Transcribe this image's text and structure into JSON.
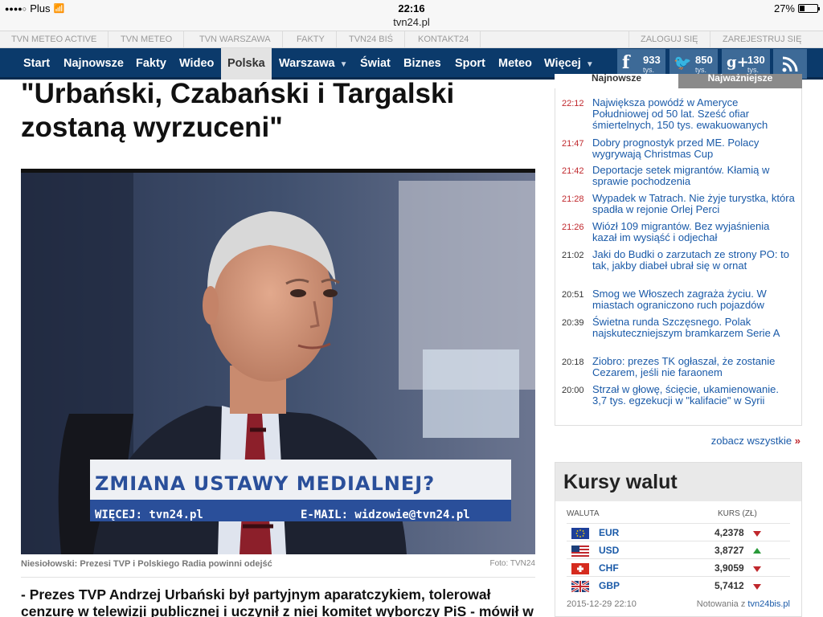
{
  "status_bar": {
    "carrier": "Plus",
    "time": "22:16",
    "battery": "27%",
    "battery_level": 0.27
  },
  "browser": {
    "url": "tvn24.pl"
  },
  "service_links": [
    "TVN METEO ACTIVE",
    "TVN METEO",
    "TVN WARSZAWA",
    "FAKTY",
    "TVN24 BiŚ",
    "KONTAKT24"
  ],
  "account_links": {
    "login": "ZALOGUJ SIĘ",
    "register": "ZAREJESTRUJ SIĘ"
  },
  "nav": {
    "items": [
      "Start",
      "Najnowsze",
      "Fakty",
      "Wideo",
      "Polska",
      "Warszawa",
      "Świat",
      "Biznes",
      "Sport",
      "Meteo",
      "Więcej"
    ],
    "active": "Polska"
  },
  "social": {
    "facebook": {
      "count": "933",
      "unit": "tys.",
      "glyph": "f"
    },
    "twitter": {
      "count": "850",
      "unit": "tys.",
      "glyph": "🐦"
    },
    "gplus": {
      "count": "130",
      "unit": "tys.",
      "glyph": "g+"
    },
    "rss": {
      "glyph": "rss-icon"
    }
  },
  "article": {
    "title": "\"Urbański, Czabański i Targalski zostaną wyrzuceni\"",
    "tv_banner_main": "ZMIANA USTAWY MEDIALNEJ?",
    "tv_banner_left": "WIĘCEJ: tvn24.pl",
    "tv_banner_right": "E-MAIL: widzowie@tvn24.pl",
    "caption": "Niesiołowski: Prezesi TVP i Polskiego Radia powinni odejść",
    "photo_credit": "Foto: TVN24",
    "lead": "- Prezes TVP Andrzej Urbański był partyjnym aparatczykiem, tolerował cenzurę w telewizji publicznej i uczynił z niej komitet wyborczy PiS - mówił w"
  },
  "news": {
    "tab_latest": "Najnowsze",
    "tab_important": "Najważniejsze",
    "items": [
      {
        "time": "22:12",
        "text": "Największa powódź w Ameryce Południowej od 50 lat. Sześć ofiar śmiertelnych, 150 tys. ewakuowanych",
        "red": true
      },
      {
        "time": "21:47",
        "text": "Dobry prognostyk przed ME. Polacy wygrywają Christmas Cup",
        "red": true
      },
      {
        "time": "21:42",
        "text": "Deportacje setek migrantów. Kłamią w sprawie pochodzenia",
        "red": true
      },
      {
        "time": "21:28",
        "text": "Wypadek w Tatrach. Nie żyje turystka, która spadła w rejonie Orlej Perci",
        "red": true
      },
      {
        "time": "21:26",
        "text": "Wiózł 109 migrantów. Bez wyjaśnienia kazał im wysiąść i odjechał",
        "red": true
      },
      {
        "time": "21:02",
        "text": "Jaki do Budki o zarzutach ze strony PO: to tak, jakby diabeł ubrał się w ornat",
        "red": false
      },
      {
        "time": "20:51",
        "text": "Smog we Włoszech zagraża życiu. W miastach ograniczono ruch pojazdów",
        "red": false
      },
      {
        "time": "20:39",
        "text": "Świetna runda Szczęsnego. Polak najskuteczniejszym bramkarzem Serie A",
        "red": false
      },
      {
        "time": "20:18",
        "text": "Ziobro: prezes TK ogłaszał, że zostanie Cezarem, jeśli nie faraonem",
        "red": false
      },
      {
        "time": "20:00",
        "text": "Strzał w głowę, ścięcie, ukamienowanie. 3,7 tys. egzekucji w \"kalifacie\" w Syrii",
        "red": false
      }
    ],
    "see_all": "zobacz wszystkie",
    "see_all_arrow": "»"
  },
  "currency": {
    "title": "Kursy walut",
    "col_currency": "WALUTA",
    "col_rate": "KURS (ZŁ)",
    "rows": [
      {
        "code": "EUR",
        "value": "4,2378",
        "trend": "down",
        "flag": "eu-flag"
      },
      {
        "code": "USD",
        "value": "3,8727",
        "trend": "up",
        "flag": "us-flag"
      },
      {
        "code": "CHF",
        "value": "3,9059",
        "trend": "down",
        "flag": "ch-flag"
      },
      {
        "code": "GBP",
        "value": "5,7412",
        "trend": "down",
        "flag": "gb-flag"
      }
    ],
    "date": "2015-12-29 22:10",
    "source_label": "Notowania z",
    "source_link": "tvn24bis.pl"
  }
}
